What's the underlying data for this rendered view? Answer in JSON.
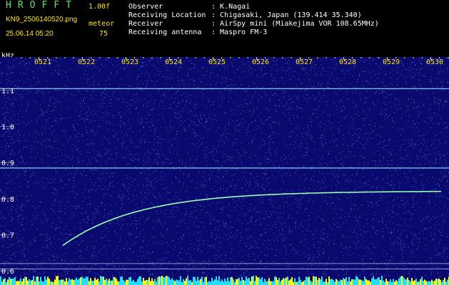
{
  "header": {
    "brand": "HROFFT",
    "version": "1.00f",
    "filename": "KN9_2506140520.png",
    "mode": "meteor",
    "datetime": "25.06.14 05:20",
    "count": "75"
  },
  "station": [
    {
      "label": "Observer",
      "value": ": K.Nagai"
    },
    {
      "label": "Receiving Location",
      "value": ": Chigasaki, Japan (139.414 35.340)"
    },
    {
      "label": "Receiver",
      "value": ": AirSpy mini (Miakejima VOR 108.65MHz)"
    },
    {
      "label": "Receiving antenna",
      "value": ": Maspro FM-3"
    }
  ],
  "spectrogram": {
    "y_unit": "kHz",
    "time_labels": [
      "0521",
      "0522",
      "0523",
      "0524",
      "0525",
      "0526",
      "0527",
      "0528",
      "0529",
      "0530"
    ],
    "freq_labels": [
      "1.1",
      "1.0",
      "0.9",
      "0.8",
      "0.7",
      "0.6"
    ],
    "freq_values": [
      1.1,
      1.0,
      0.9,
      0.8,
      0.7,
      0.6
    ],
    "carrier_lines_khz": [
      1.105,
      0.885,
      0.62,
      0.605
    ],
    "meteor_echo": {
      "start_khz": 0.67,
      "end_khz": 0.82
    },
    "colors": {
      "background": "#0a0a6e",
      "noise": "#3f5fd8",
      "line": "#8fd8ff",
      "echo": "#9cffb0",
      "band": "#ffff00",
      "band_alt": "#21e0ff"
    }
  }
}
